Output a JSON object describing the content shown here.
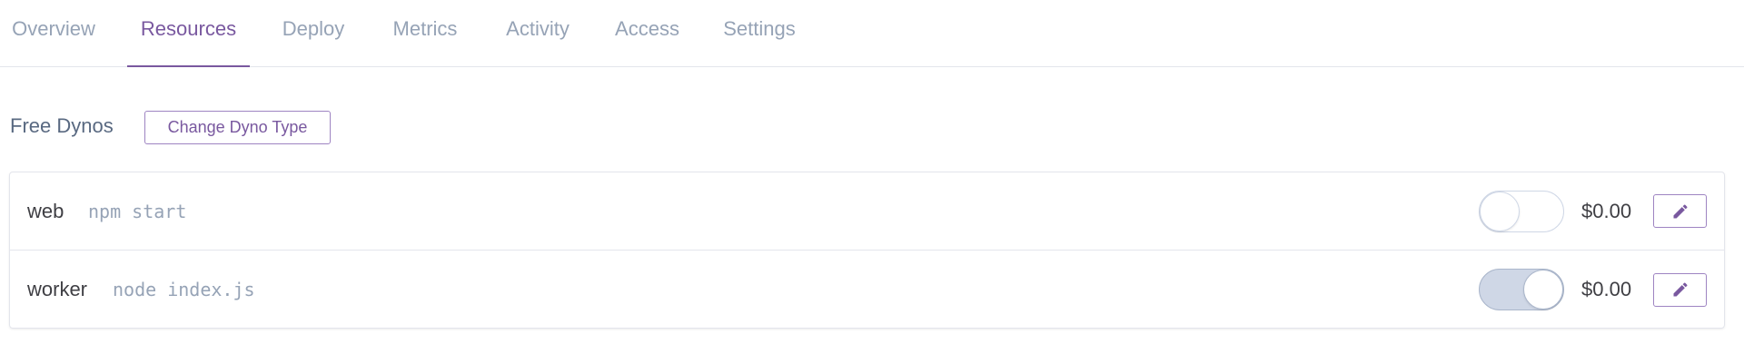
{
  "tabs": [
    {
      "label": "Overview",
      "active": false
    },
    {
      "label": "Resources",
      "active": true
    },
    {
      "label": "Deploy",
      "active": false
    },
    {
      "label": "Metrics",
      "active": false
    },
    {
      "label": "Activity",
      "active": false
    },
    {
      "label": "Access",
      "active": false
    },
    {
      "label": "Settings",
      "active": false
    }
  ],
  "section": {
    "title": "Free Dynos",
    "change_button": "Change Dyno Type"
  },
  "dynos": [
    {
      "name": "web",
      "command": "npm start",
      "enabled": false,
      "price": "$0.00",
      "edit_icon": "pencil-icon"
    },
    {
      "name": "worker",
      "command": "node index.js",
      "enabled": true,
      "price": "$0.00",
      "edit_icon": "pencil-icon"
    }
  ],
  "colors": {
    "accent": "#79589f",
    "muted_text": "#96a3b6",
    "border": "#e3e5ec"
  }
}
